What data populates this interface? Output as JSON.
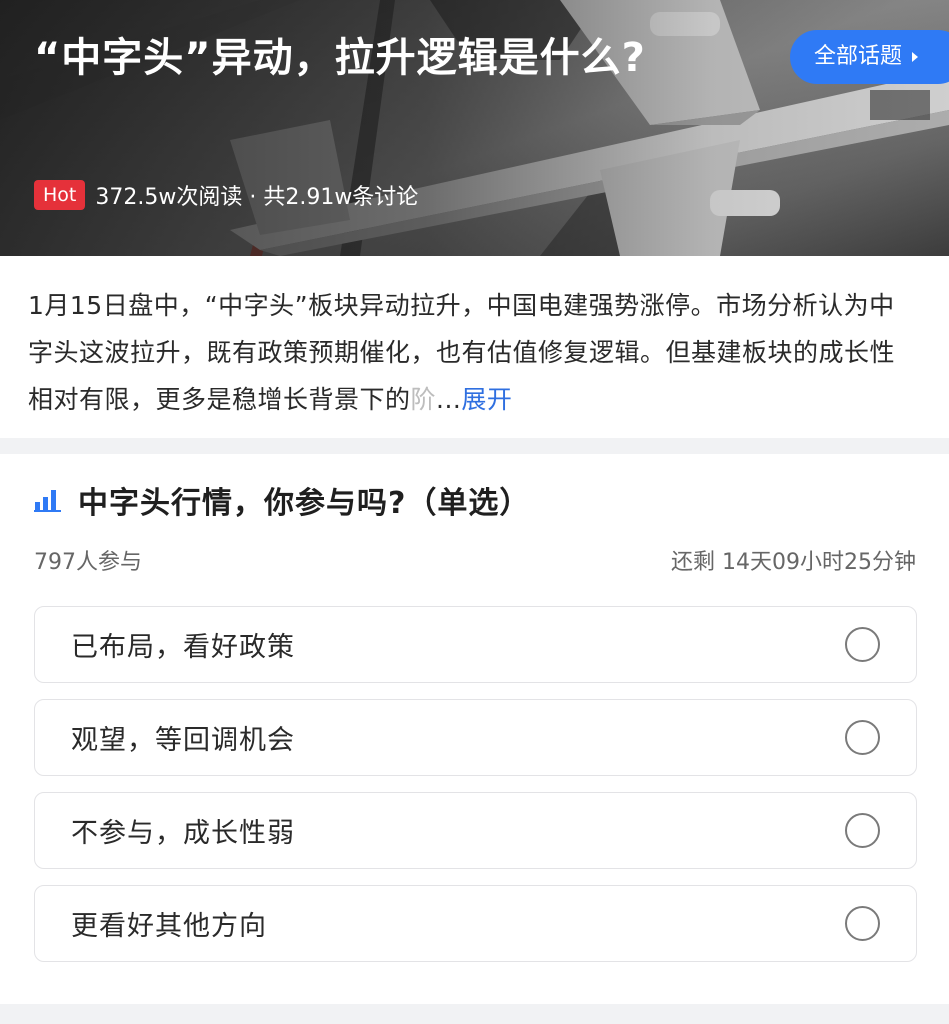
{
  "hero": {
    "title": "“中字头”异动，拉升逻辑是什么?",
    "hot_badge": "Hot",
    "stats": "372.5w次阅读 · 共2.91w条讨论",
    "topics_button": "全部话题",
    "topics_icon": "caret-right-icon"
  },
  "description": {
    "text_main": "1月15日盘中，“中字头”板块异动拉升，中国电建强势涨停。市场分析认为中字头这波拉升，既有政策预期催化，也有估值修复逻辑。但基建板块的成长性相对有限，更多是稳增长背景下的",
    "text_faded": "阶",
    "ellipsis": "...",
    "expand_label": "展开"
  },
  "poll": {
    "icon": "bar-chart-icon",
    "title": "中字头行情，你参与吗?（单选）",
    "participants": "797人参与",
    "remaining": "还剩 14天09小时25分钟",
    "options": [
      {
        "label": "已布局，看好政策"
      },
      {
        "label": "观望，等回调机会"
      },
      {
        "label": "不参与，成长性弱"
      },
      {
        "label": "更看好其他方向"
      }
    ]
  },
  "colors": {
    "accent": "#2f7af5",
    "hot": "#e5313a",
    "link": "#2f6fe0"
  }
}
